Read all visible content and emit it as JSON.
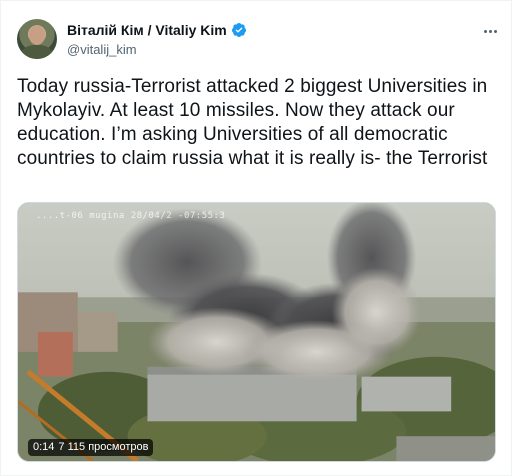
{
  "user": {
    "display_name": "Віталій Кім / Vitaliy Kim",
    "handle": "@vitalij_kim"
  },
  "icons": {
    "verified": "verified-badge-icon",
    "more": "more-options-icon",
    "accent_color": "#1d9bf0"
  },
  "tweet": {
    "text": "Today russia-Terrorist attacked 2 biggest Universities in Mykolayiv. At least 10 missiles. Now they attack our education. I’m asking Universities of all democratic countries to claim russia what it is really is- the Terrorist"
  },
  "media": {
    "overlay_text": "....t-06 mugina 28/04/2 -07:55:3",
    "duration": "0:14",
    "views": "7 115 просмотров"
  }
}
